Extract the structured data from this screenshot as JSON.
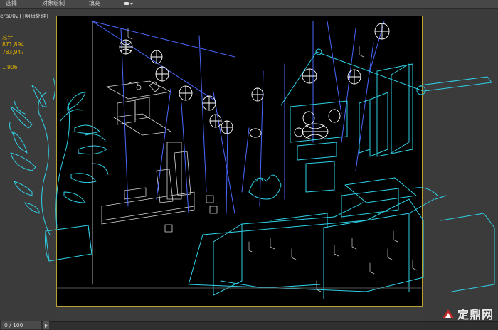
{
  "menu": {
    "items": [
      {
        "label": "选择"
      },
      {
        "label": "对象绘制"
      },
      {
        "label": "填充"
      }
    ]
  },
  "viewport_label": "era002] [明暗处理]",
  "stats": {
    "total_label": "总计",
    "polys": "871,894",
    "verts": "783,947",
    "fps": "1.906"
  },
  "timeline": {
    "frame_counter": "0 / 100"
  },
  "watermark": {
    "text": "定鼎网"
  },
  "colors": {
    "wire_cyan": "#2fd0e6",
    "wire_blue": "#4a68ff",
    "wire_white": "#ffffff",
    "border_gold": "#b9a233",
    "stat_text": "#e0b000"
  }
}
